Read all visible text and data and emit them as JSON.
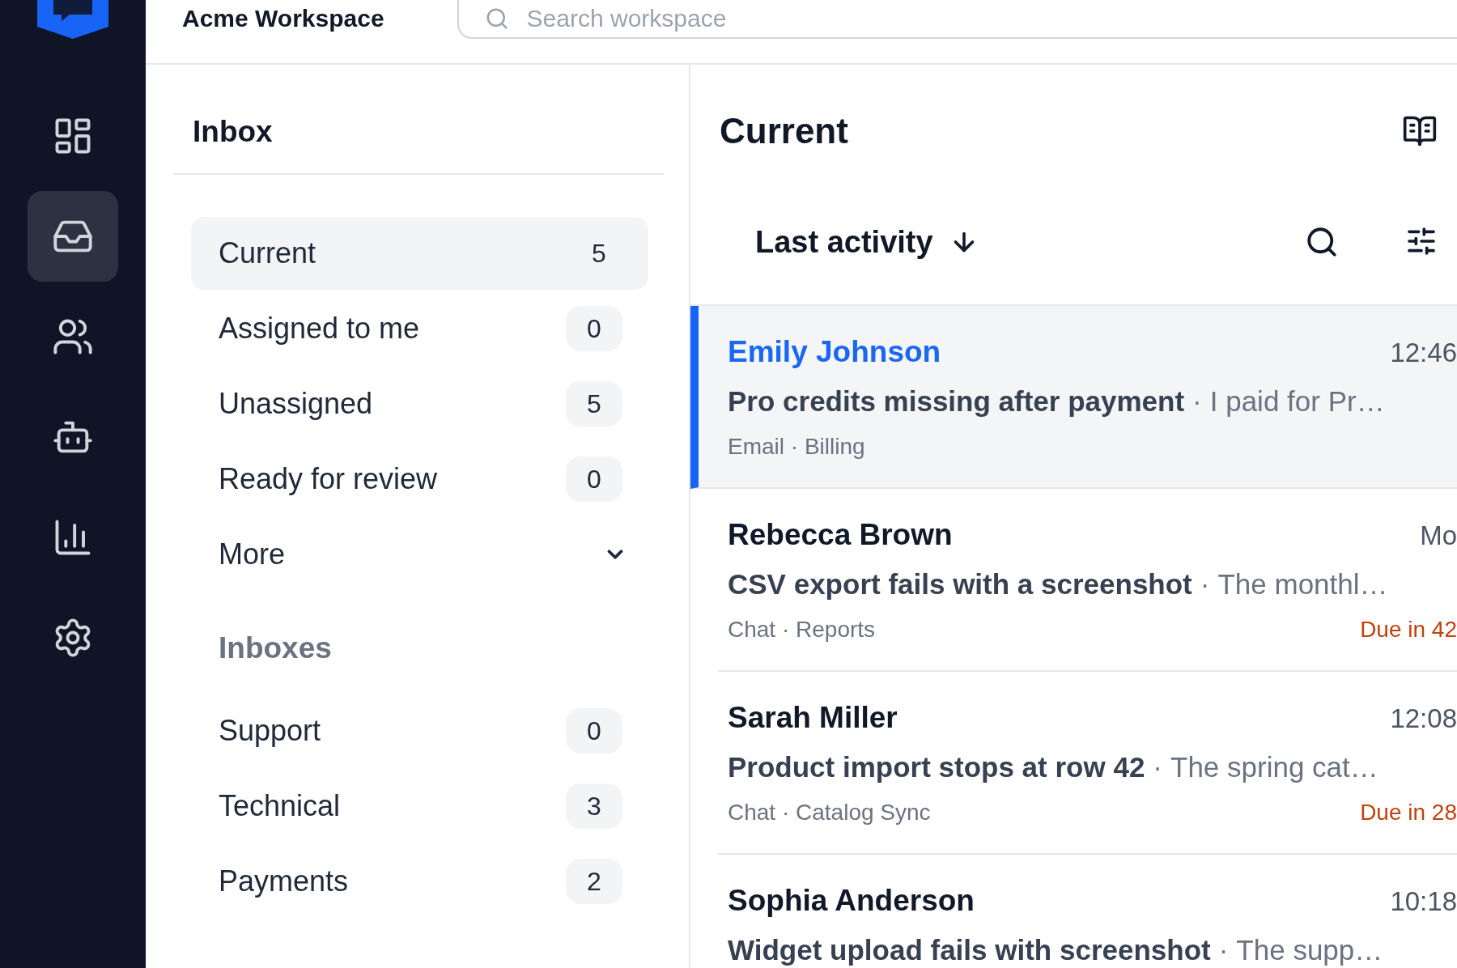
{
  "workspace": {
    "title": "Acme Workspace",
    "search_placeholder": "Search workspace"
  },
  "rail": [
    {
      "selected": false
    },
    {
      "selected": true
    },
    {
      "selected": false
    },
    {
      "selected": false
    },
    {
      "selected": false
    },
    {
      "selected": false
    }
  ],
  "inbox": {
    "title": "Inbox",
    "views": [
      {
        "label": "Current",
        "count": "5",
        "selected": true
      },
      {
        "label": "Assigned to me",
        "count": "0",
        "selected": false
      },
      {
        "label": "Unassigned",
        "count": "5",
        "selected": false
      },
      {
        "label": "Ready for review",
        "count": "0",
        "selected": false
      }
    ],
    "more": {
      "label": "More",
      "expanded": false
    },
    "section": "Inboxes",
    "inboxes": [
      {
        "label": "Support",
        "count": "0",
        "selected": false
      },
      {
        "label": "Technical",
        "count": "3",
        "selected": false
      },
      {
        "label": "Payments",
        "count": "2",
        "selected": false
      }
    ]
  },
  "list": {
    "title": "Current",
    "sort": "Last activity",
    "conversations": [
      {
        "name": "Emily Johnson",
        "time": "12:46",
        "subject": "Pro credits missing after payment",
        "separator": "·",
        "preview": "I paid for Pr…",
        "meta": "Email · Billing",
        "selected": true
      },
      {
        "name": "Rebecca Brown",
        "time": "Mo",
        "subject": "CSV export fails with a screenshot",
        "separator": "·",
        "preview": "The monthl…",
        "meta": "Chat · Reports",
        "due": "Due in 42",
        "selected": false
      },
      {
        "name": "Sarah Miller",
        "time": "12:08",
        "subject": "Product import stops at row 42",
        "separator": "·",
        "preview": "The spring cat…",
        "meta": "Chat · Catalog Sync",
        "due": "Due in 28",
        "selected": false
      },
      {
        "name": "Sophia Anderson",
        "time": "10:18",
        "subject": "Widget upload fails with screenshot",
        "separator": "·",
        "preview": "The supp…",
        "selected": false
      }
    ]
  }
}
